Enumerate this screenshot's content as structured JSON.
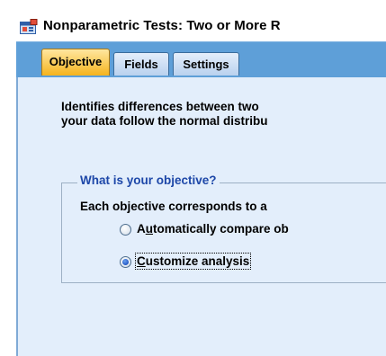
{
  "window": {
    "title": "Nonparametric Tests: Two or More R",
    "icon": "spss-dialog-icon"
  },
  "tabs": [
    {
      "label": "Objective",
      "active": true
    },
    {
      "label": "Fields",
      "active": false
    },
    {
      "label": "Settings",
      "active": false
    }
  ],
  "description": {
    "line1": "Identifies differences between two",
    "line2": "your data follow the normal distribu"
  },
  "objective_group": {
    "legend": "What is your objective?",
    "info": "Each objective corresponds to a",
    "options": [
      {
        "label_pre": "A",
        "mnemonic": "u",
        "label_post": "tomatically compare ob",
        "selected": false
      },
      {
        "label_pre": "",
        "mnemonic": "C",
        "label_post": "ustomize analysis",
        "selected": true,
        "focused": true
      }
    ]
  },
  "colors": {
    "tab_strip": "#5e9fd8",
    "active_tab": "#f5b31e",
    "panel_background": "#e3eefb",
    "legend_text": "#1d47a8"
  }
}
